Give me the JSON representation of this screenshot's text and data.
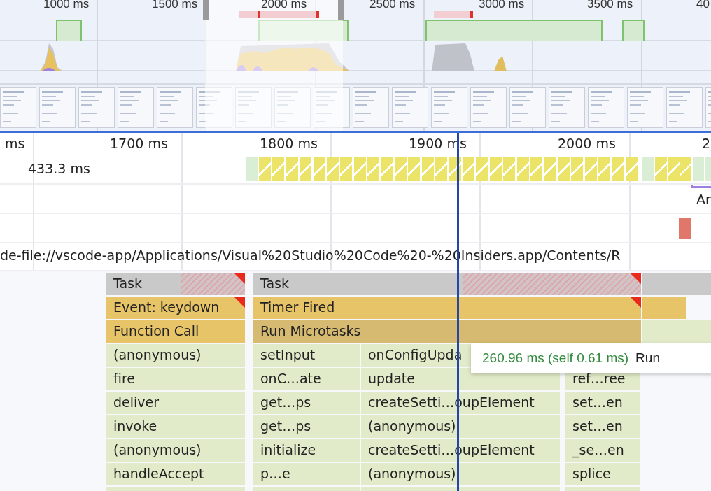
{
  "overview": {
    "time_labels": [
      "1000 ms",
      "1500 ms",
      "2000 ms",
      "2500 ms",
      "3000 ms",
      "3500 ms",
      "40"
    ]
  },
  "timeline": {
    "time_labels": [
      "ms",
      "1700 ms",
      "1800 ms",
      "1900 ms",
      "2000 ms",
      "2"
    ],
    "frames": {
      "duration": "433.3 ms"
    },
    "interactions": {
      "label": "Ar"
    },
    "thread": {
      "url": "de-file://vscode-app/Applications/Visual%20Studio%20Code%20-%20Insiders.app/Contents/R"
    },
    "flame_rows": [
      [
        {
          "label": "Task",
          "kind": "task",
          "warning": true
        },
        {
          "label": "Task",
          "kind": "task",
          "warning": true
        }
      ],
      [
        {
          "label": "Event: keydown",
          "kind": "event",
          "warning": true
        },
        {
          "label": "Timer Fired",
          "kind": "event",
          "warning": true
        }
      ],
      [
        {
          "label": "Function Call",
          "kind": "function",
          "warning": false
        },
        {
          "label": "Run Microtasks",
          "kind": "microtask",
          "warning": false
        }
      ],
      [
        {
          "label": "(anonymous)",
          "kind": "js"
        },
        {
          "label": "setInput",
          "kind": "js"
        },
        {
          "label": "onConfigUpda",
          "kind": "js"
        }
      ],
      [
        {
          "label": "fire",
          "kind": "js"
        },
        {
          "label": "onC…ate",
          "kind": "js"
        },
        {
          "label": "update",
          "kind": "js"
        },
        {
          "label": "ref…ree",
          "kind": "js"
        }
      ],
      [
        {
          "label": "deliver",
          "kind": "js"
        },
        {
          "label": "get…ps",
          "kind": "js"
        },
        {
          "label": "createSetti…oupElement",
          "kind": "js"
        },
        {
          "label": "set…en",
          "kind": "js"
        }
      ],
      [
        {
          "label": "invoke",
          "kind": "js"
        },
        {
          "label": "get…ps",
          "kind": "js"
        },
        {
          "label": "(anonymous)",
          "kind": "js"
        },
        {
          "label": "set…en",
          "kind": "js"
        }
      ],
      [
        {
          "label": "(anonymous)",
          "kind": "js"
        },
        {
          "label": "initialize",
          "kind": "js"
        },
        {
          "label": "createSetti…oupElement",
          "kind": "js"
        },
        {
          "label": "_se…en",
          "kind": "js"
        }
      ],
      [
        {
          "label": "handleAccept",
          "kind": "js"
        },
        {
          "label": "p…e",
          "kind": "js"
        },
        {
          "label": "(anonymous)",
          "kind": "js"
        },
        {
          "label": "splice",
          "kind": "js"
        }
      ],
      [
        {
          "kind": "js"
        },
        {
          "kind": "js"
        },
        {
          "kind": "js"
        },
        {
          "kind": "js"
        }
      ]
    ],
    "tooltip": {
      "time": "260.96 ms (self 0.61 ms)",
      "name": "Run"
    }
  }
}
